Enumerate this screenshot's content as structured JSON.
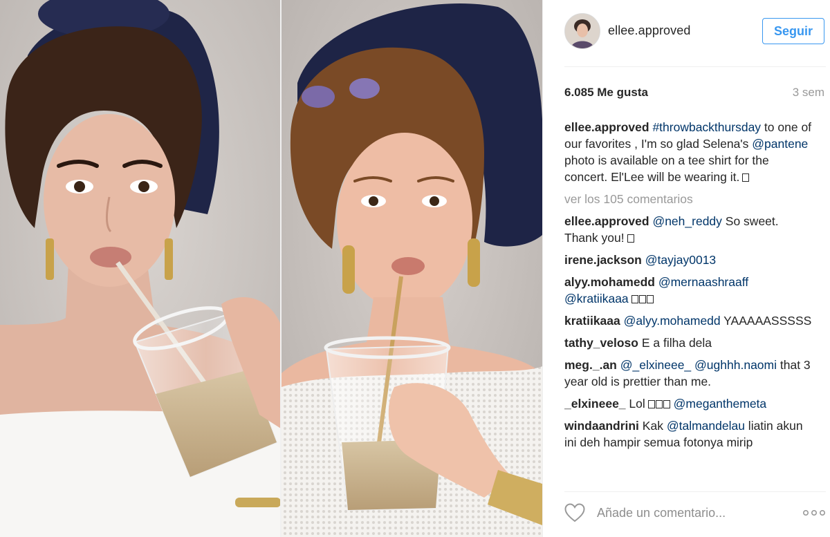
{
  "header": {
    "username": "ellee.approved",
    "follow_label": "Seguir"
  },
  "stats": {
    "likes": "6.085 Me gusta",
    "time_ago": "3 sem"
  },
  "caption": {
    "user": "ellee.approved",
    "hashtag": "#throwbackthursday",
    "text_1": " to one of our favorites , I'm so glad Selena's ",
    "mention": "@pantene",
    "text_2": " photo is available on a tee shirt for the concert. El'Lee will be wearing it."
  },
  "view_comments": "ver los 105 comentarios",
  "comments": [
    {
      "user": "ellee.approved",
      "mention": "@neh_reddy",
      "text": " So sweet. Thank you!"
    },
    {
      "user": "irene.jackson",
      "mention": "@tayjay0013",
      "text": ""
    },
    {
      "user": "alyy.mohamedd",
      "mention": "@mernaashraaff",
      "mention2": "@kratiikaaa",
      "text": ""
    },
    {
      "user": "kratiikaaa",
      "mention": "@alyy.mohamedd",
      "text": " YAAAAASSSSS"
    },
    {
      "user": "tathy_veloso",
      "text": " E a filha dela"
    },
    {
      "user": "meg._.an",
      "mention": "@_elxineee_",
      "mention2": "@ughhh.naomi",
      "text": " that 3 year old is prettier than me."
    },
    {
      "user": "_elxineee_",
      "text": " Lol",
      "mention": "@meganthemeta"
    },
    {
      "user": "windaandrini",
      "text_1": " Kak ",
      "mention": "@talmandelau",
      "text": " liatin akun ini deh hampir semua fotonya mirip"
    }
  ],
  "footer": {
    "comment_placeholder": "Añade un comentario...",
    "heart_icon": "heart-outline-icon",
    "more_icon": "more-options-icon"
  },
  "colors": {
    "link": "#003569",
    "follow": "#3897f0",
    "muted": "#999999",
    "text": "#262626"
  }
}
